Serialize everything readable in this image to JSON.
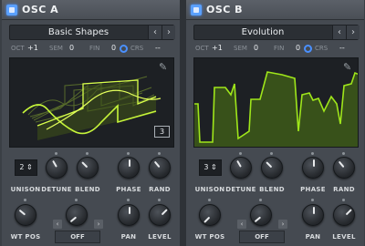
{
  "osc_a": {
    "title": "OSC A",
    "wavetable_name": "Basic Shapes",
    "params": {
      "oct_label": "OCT",
      "oct_value": "+1",
      "sem_label": "SEM",
      "sem_value": "0",
      "fin_label": "FIN",
      "fin_value": "0",
      "crs_label": "CRS",
      "crs_value": "--"
    },
    "frame_number": "3",
    "unison_value": "2",
    "knob_labels": {
      "unison": "UNISON",
      "detune": "DETUNE",
      "blend": "BLEND",
      "phase": "PHASE",
      "rand": "RAND",
      "wt_pos": "WT POS",
      "off": "OFF",
      "pan": "PAN",
      "level": "LEVEL"
    }
  },
  "osc_b": {
    "title": "OSC B",
    "wavetable_name": "Evolution",
    "params": {
      "oct_label": "OCT",
      "oct_value": "+1",
      "sem_label": "SEM",
      "sem_value": "0",
      "fin_label": "FIN",
      "fin_value": "0",
      "crs_label": "CRS",
      "crs_value": "--"
    },
    "unison_value": "3",
    "knob_labels": {
      "unison": "UNISON",
      "detune": "DETUNE",
      "blend": "BLEND",
      "phase": "PHASE",
      "rand": "RAND",
      "wt_pos": "WT POS",
      "off": "OFF",
      "pan": "PAN",
      "level": "LEVEL"
    }
  },
  "colors": {
    "accent": "#4a90ff",
    "wave_green": "#9fe61a",
    "panel": "#454a51",
    "display_bg": "#1d2024"
  },
  "icons": {
    "power": "power-icon",
    "arrow_left": "arrow-left-icon",
    "arrow_right": "arrow-right-icon",
    "pencil": "pencil-icon",
    "crs": "crs-icon"
  }
}
